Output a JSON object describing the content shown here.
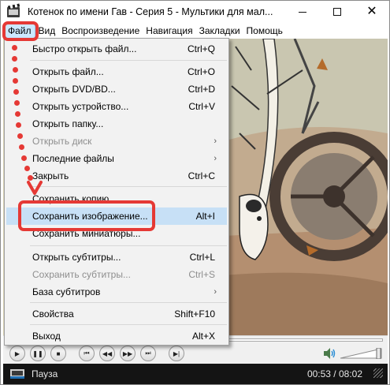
{
  "window": {
    "title": "Котенок по имени Гав - Серия 5 - Мультики для мал..."
  },
  "menubar": {
    "items": [
      "Файл",
      "Вид",
      "Воспроизведение",
      "Навигация",
      "Закладки",
      "Помощь"
    ]
  },
  "file_menu": {
    "items": [
      {
        "label": "Быстро открыть файл...",
        "shortcut": "Ctrl+Q"
      },
      {
        "label": "Открыть файл...",
        "shortcut": "Ctrl+O"
      },
      {
        "label": "Открыть DVD/BD...",
        "shortcut": "Ctrl+D"
      },
      {
        "label": "Открыть устройство...",
        "shortcut": "Ctrl+V"
      },
      {
        "label": "Открыть папку...",
        "shortcut": ""
      },
      {
        "label": "Открыть диск",
        "shortcut": "›"
      },
      {
        "label": "Последние файлы",
        "shortcut": "›"
      },
      {
        "label": "Закрыть",
        "shortcut": "Ctrl+C"
      },
      {
        "label": "Сохранить копию...",
        "shortcut": ""
      },
      {
        "label": "Сохранить изображение...",
        "shortcut": "Alt+I"
      },
      {
        "label": "Сохранить миниатюры...",
        "shortcut": ""
      },
      {
        "label": "Открыть субтитры...",
        "shortcut": "Ctrl+L"
      },
      {
        "label": "Сохранить субтитры...",
        "shortcut": "Ctrl+S"
      },
      {
        "label": "База субтитров",
        "shortcut": "›"
      },
      {
        "label": "Свойства",
        "shortcut": "Shift+F10"
      },
      {
        "label": "Выход",
        "shortcut": "Alt+X"
      }
    ]
  },
  "status": {
    "state": "Пауза",
    "time": "00:53 / 08:02"
  },
  "colors": {
    "annotation": "#e53935",
    "highlight": "#c7e0f6",
    "status_bg": "#141414"
  }
}
